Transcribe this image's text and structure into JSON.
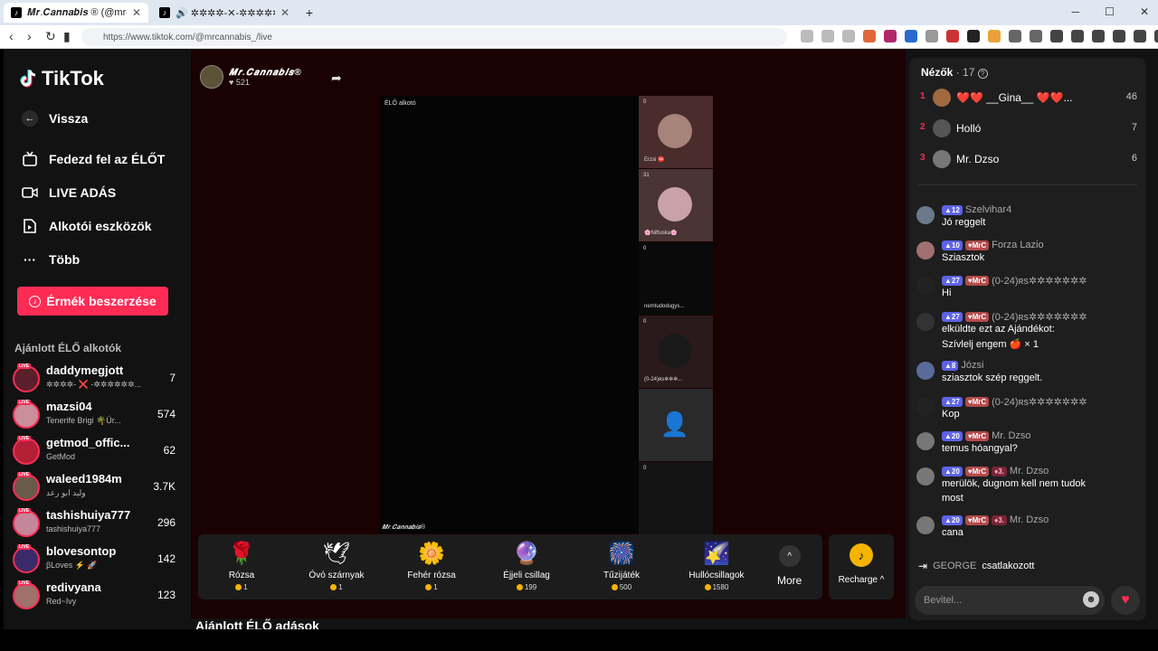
{
  "browser": {
    "tabs": [
      {
        "title": "𝑴𝒓.𝑪𝒂𝒏𝒏𝒂𝒃𝒊𝒔 ® (@mrcanna",
        "close": "✕"
      },
      {
        "title": "🔊 ✲✲✲✲-✕-✲✲✲✲✲✲ (@dadd",
        "close": "✕"
      }
    ],
    "new_tab": "+",
    "url": "https://www.tiktok.com/@mrcannabis_/live"
  },
  "sidebar": {
    "brand": "TikTok",
    "back": "Vissza",
    "nav": [
      {
        "label": "Fedezd fel az ÉLŐT",
        "icon": "tv-icon"
      },
      {
        "label": "LIVE ADÁS",
        "icon": "camera-icon"
      },
      {
        "label": "Alkotói eszközök",
        "icon": "creator-tools-icon"
      },
      {
        "label": "Több",
        "icon": "more-icon"
      }
    ],
    "coins_button": "Érmék beszerzése",
    "recommended_title": "Ajánlott ÉLŐ alkotók",
    "live_tag": "LIVE",
    "creators": [
      {
        "name": "daddymegjott",
        "sub": "✲✲✲✲- ❌ -✲✲✲✲✲✲...",
        "count": "7",
        "color": "#5a1f2a"
      },
      {
        "name": "mazsi04",
        "sub": "Tenerife Brigi 🌴Úr...",
        "count": "574",
        "color": "#c98f9a"
      },
      {
        "name": "getmod_offic...",
        "sub": "GetMod",
        "count": "62",
        "color": "#b32036"
      },
      {
        "name": "waleed1984m",
        "sub": "وليد ابو رعد",
        "count": "3.7K",
        "color": "#6a5a4a"
      },
      {
        "name": "tashishuiya777",
        "sub": "tashishuiya777",
        "count": "296",
        "color": "#c5869b"
      },
      {
        "name": "blovesontop",
        "sub": "βLoves ⚡ 🚀",
        "count": "142",
        "color": "#3a2a6a"
      },
      {
        "name": "redivyana",
        "sub": "Red~Ivy",
        "count": "123",
        "color": "#a0706a"
      }
    ]
  },
  "stage": {
    "host_name": "𝑴𝒓.𝑪𝒂𝒏𝒏𝒂𝒃𝒊𝒔®",
    "host_likes": "♥ 521",
    "video_label": "ÉLŐ alkotó",
    "watermark": "𝑴𝒓.𝑪𝒂𝒏𝒏𝒂𝒃𝒊𝒔®",
    "guests": [
      {
        "num": "0",
        "name": "Erzsi ⛔",
        "color": "#4a2c2c",
        "avatar": "#a6847a"
      },
      {
        "num": "31",
        "name": "🌸Niftuska🌸",
        "color": "#4a3434",
        "avatar": "#c9a2a8"
      },
      {
        "num": "0",
        "name": "nemtudodugys...",
        "color": "#0a0a0a",
        "avatar": ""
      },
      {
        "num": "0",
        "name": "(0-24)ʀs✲✲✲...",
        "color": "#2a1a1c",
        "avatar": "#1a1a1a"
      },
      {
        "num": "",
        "name": "",
        "color": "#2a2a2a",
        "avatar": ""
      },
      {
        "num": "0",
        "name": "",
        "color": "#141414",
        "avatar": ""
      }
    ],
    "gifts": [
      {
        "name": "Rózsa",
        "price": "1",
        "icon": "🌹"
      },
      {
        "name": "Óvó szárnyak",
        "price": "1",
        "icon": "🕊"
      },
      {
        "name": "Fehér rózsa",
        "price": "1",
        "icon": "🌼"
      },
      {
        "name": "Éjjeli csillag",
        "price": "199",
        "icon": "🔮"
      },
      {
        "name": "Tűzijáték",
        "price": "500",
        "icon": "🎆"
      },
      {
        "name": "Hullócsillagok",
        "price": "1580",
        "icon": "🌠"
      }
    ],
    "more_label": "More",
    "recharge_label": "Recharge ^",
    "recommended_live_title": "Ajánlott ÉLŐ adások"
  },
  "panel": {
    "viewers_title": "Nézők",
    "viewers_count": "· 17",
    "viewers": [
      {
        "rank": "1",
        "name": "❤️❤️ __Gina__ ❤️❤️...",
        "count": "46",
        "color": "#a06a40"
      },
      {
        "rank": "2",
        "name": "Holló",
        "count": "7",
        "color": "#555"
      },
      {
        "rank": "3",
        "name": "Mr. Dzso",
        "count": "6",
        "color": "#777"
      }
    ],
    "chat": [
      {
        "level": "12",
        "fan": "",
        "rank": "",
        "user": "Szelvihar4",
        "msg": "Jó reggelt",
        "color": "#6a7a8a"
      },
      {
        "level": "10",
        "fan": "MrC",
        "rank": "",
        "user": "Forza Lazio",
        "msg": "Sziasztok",
        "color": "#a07070"
      },
      {
        "level": "27",
        "fan": "MrC",
        "rank": "",
        "user": "(0-24)ʀs✲✲✲✲✲✲✲",
        "msg": "Hi",
        "color": "#222"
      },
      {
        "level": "27",
        "fan": "MrC",
        "rank": "",
        "user": "(0-24)ʀs✲✲✲✲✲✲✲",
        "msg": "elküldte ezt az Ajándékot:",
        "msg2": "Szívlelj engem 🍎 × 1",
        "color": "#333"
      },
      {
        "level": "8",
        "fan": "",
        "rank": "",
        "user": "Józsi",
        "msg": "sziasztok szép reggelt.",
        "color": "#5a6a9a"
      },
      {
        "level": "27",
        "fan": "MrC",
        "rank": "",
        "user": "(0-24)ʀs✲✲✲✲✲✲✲",
        "msg": "Kop",
        "color": "#222"
      },
      {
        "level": "20",
        "fan": "MrC",
        "rank": "",
        "user": "Mr. Dzso",
        "msg": "temus hóangyal?",
        "color": "#777"
      },
      {
        "level": "20",
        "fan": "MrC",
        "rank": "3.",
        "user": "Mr. Dzso",
        "msg": "merülök, dugnom kell nem tudok",
        "msg2": "most",
        "color": "#777"
      },
      {
        "level": "20",
        "fan": "MrC",
        "rank": "3.",
        "user": "Mr. Dzso",
        "msg": "cana",
        "color": "#777"
      }
    ],
    "joined_user": "GEORGE",
    "joined_text": "csatlakozott",
    "input_placeholder": "Bevitel..."
  }
}
